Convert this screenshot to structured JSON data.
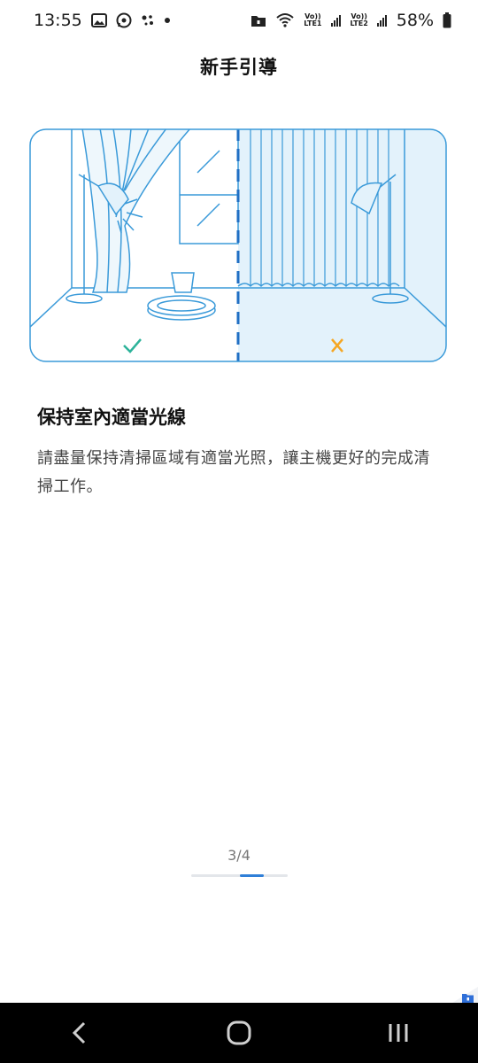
{
  "status_bar": {
    "time": "13:55",
    "battery": "58%",
    "sim1_top": "Vo))",
    "sim1_bottom": "LTE1",
    "sim2_top": "Vo))",
    "sim2_bottom": "LTE2"
  },
  "header": {
    "title": "新手引導"
  },
  "illustration": {
    "good_mark": "✓",
    "bad_mark": "✕",
    "colors": {
      "line": "#3a9ad9",
      "fill": "#e3f2fb",
      "check": "#2db39a",
      "cross": "#f5a623"
    }
  },
  "tip": {
    "title": "保持室內適當光線",
    "description": "請盡量保持清掃區域有適當光照，讓主機更好的完成清掃工作。"
  },
  "pager": {
    "label": "3/4",
    "current": 3,
    "total": 4,
    "accent": "#2f7fd8"
  },
  "nav_bar": {
    "back_icon": "back-icon",
    "home_icon": "home-icon",
    "recents_icon": "recents-icon"
  }
}
